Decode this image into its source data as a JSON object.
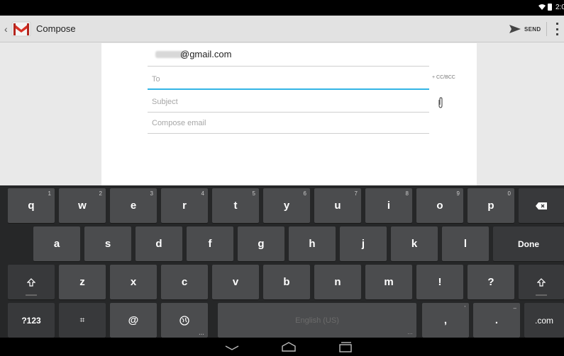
{
  "status_bar": {
    "time": "2:0"
  },
  "action_bar": {
    "title": "Compose",
    "send_label": "SEND"
  },
  "compose": {
    "from_domain": "@gmail.com",
    "to_placeholder": "To",
    "cc_bcc_label": "+ CC/BCC",
    "subject_placeholder": "Subject",
    "body_placeholder": "Compose email"
  },
  "keyboard": {
    "row1": [
      {
        "label": "q",
        "hint": "1"
      },
      {
        "label": "w",
        "hint": "2"
      },
      {
        "label": "e",
        "hint": "3"
      },
      {
        "label": "r",
        "hint": "4"
      },
      {
        "label": "t",
        "hint": "5"
      },
      {
        "label": "y",
        "hint": "6"
      },
      {
        "label": "u",
        "hint": "7"
      },
      {
        "label": "i",
        "hint": "8"
      },
      {
        "label": "o",
        "hint": "9"
      },
      {
        "label": "p",
        "hint": "0"
      }
    ],
    "row2": [
      "a",
      "s",
      "d",
      "f",
      "g",
      "h",
      "j",
      "k",
      "l"
    ],
    "done_label": "Done",
    "row3": [
      "z",
      "x",
      "c",
      "v",
      "b",
      "n",
      "m",
      "!",
      "?"
    ],
    "symbols_label": "?123",
    "hash_label": "⌗",
    "at_label": "@",
    "space_label": "English (US)",
    "comma_label": ",",
    "comma_hint": "'",
    "period_label": ".",
    "period_hint": "–",
    "dotcom_label": ".com"
  },
  "colors": {
    "accent": "#33b5e5",
    "gmail_red": "#d93025",
    "keyboard_bg": "#262728",
    "key_bg": "#4b4c4e"
  }
}
